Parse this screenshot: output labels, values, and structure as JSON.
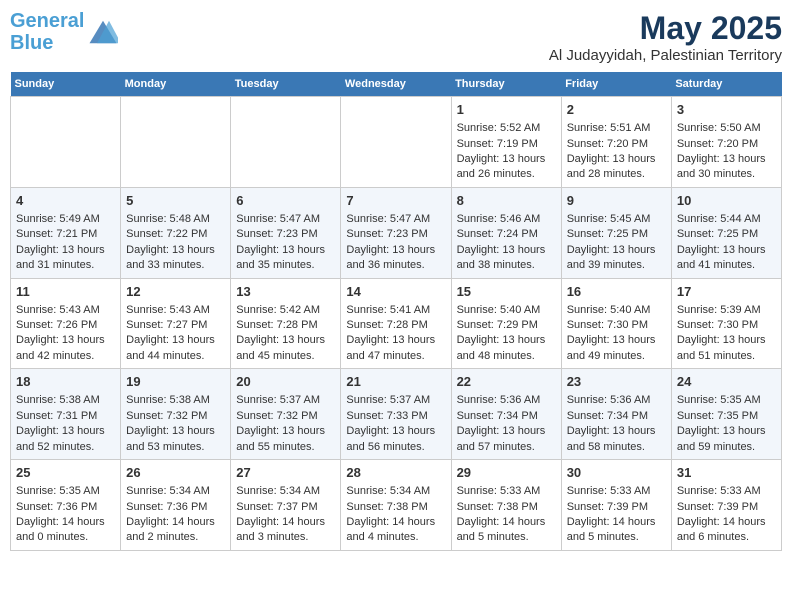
{
  "header": {
    "logo_line1": "General",
    "logo_line2": "Blue",
    "title": "May 2025",
    "subtitle": "Al Judayyidah, Palestinian Territory"
  },
  "weekdays": [
    "Sunday",
    "Monday",
    "Tuesday",
    "Wednesday",
    "Thursday",
    "Friday",
    "Saturday"
  ],
  "weeks": [
    [
      {
        "day": "",
        "content": ""
      },
      {
        "day": "",
        "content": ""
      },
      {
        "day": "",
        "content": ""
      },
      {
        "day": "",
        "content": ""
      },
      {
        "day": "1",
        "content": "Sunrise: 5:52 AM\nSunset: 7:19 PM\nDaylight: 13 hours\nand 26 minutes."
      },
      {
        "day": "2",
        "content": "Sunrise: 5:51 AM\nSunset: 7:20 PM\nDaylight: 13 hours\nand 28 minutes."
      },
      {
        "day": "3",
        "content": "Sunrise: 5:50 AM\nSunset: 7:20 PM\nDaylight: 13 hours\nand 30 minutes."
      }
    ],
    [
      {
        "day": "4",
        "content": "Sunrise: 5:49 AM\nSunset: 7:21 PM\nDaylight: 13 hours\nand 31 minutes."
      },
      {
        "day": "5",
        "content": "Sunrise: 5:48 AM\nSunset: 7:22 PM\nDaylight: 13 hours\nand 33 minutes."
      },
      {
        "day": "6",
        "content": "Sunrise: 5:47 AM\nSunset: 7:23 PM\nDaylight: 13 hours\nand 35 minutes."
      },
      {
        "day": "7",
        "content": "Sunrise: 5:47 AM\nSunset: 7:23 PM\nDaylight: 13 hours\nand 36 minutes."
      },
      {
        "day": "8",
        "content": "Sunrise: 5:46 AM\nSunset: 7:24 PM\nDaylight: 13 hours\nand 38 minutes."
      },
      {
        "day": "9",
        "content": "Sunrise: 5:45 AM\nSunset: 7:25 PM\nDaylight: 13 hours\nand 39 minutes."
      },
      {
        "day": "10",
        "content": "Sunrise: 5:44 AM\nSunset: 7:25 PM\nDaylight: 13 hours\nand 41 minutes."
      }
    ],
    [
      {
        "day": "11",
        "content": "Sunrise: 5:43 AM\nSunset: 7:26 PM\nDaylight: 13 hours\nand 42 minutes."
      },
      {
        "day": "12",
        "content": "Sunrise: 5:43 AM\nSunset: 7:27 PM\nDaylight: 13 hours\nand 44 minutes."
      },
      {
        "day": "13",
        "content": "Sunrise: 5:42 AM\nSunset: 7:28 PM\nDaylight: 13 hours\nand 45 minutes."
      },
      {
        "day": "14",
        "content": "Sunrise: 5:41 AM\nSunset: 7:28 PM\nDaylight: 13 hours\nand 47 minutes."
      },
      {
        "day": "15",
        "content": "Sunrise: 5:40 AM\nSunset: 7:29 PM\nDaylight: 13 hours\nand 48 minutes."
      },
      {
        "day": "16",
        "content": "Sunrise: 5:40 AM\nSunset: 7:30 PM\nDaylight: 13 hours\nand 49 minutes."
      },
      {
        "day": "17",
        "content": "Sunrise: 5:39 AM\nSunset: 7:30 PM\nDaylight: 13 hours\nand 51 minutes."
      }
    ],
    [
      {
        "day": "18",
        "content": "Sunrise: 5:38 AM\nSunset: 7:31 PM\nDaylight: 13 hours\nand 52 minutes."
      },
      {
        "day": "19",
        "content": "Sunrise: 5:38 AM\nSunset: 7:32 PM\nDaylight: 13 hours\nand 53 minutes."
      },
      {
        "day": "20",
        "content": "Sunrise: 5:37 AM\nSunset: 7:32 PM\nDaylight: 13 hours\nand 55 minutes."
      },
      {
        "day": "21",
        "content": "Sunrise: 5:37 AM\nSunset: 7:33 PM\nDaylight: 13 hours\nand 56 minutes."
      },
      {
        "day": "22",
        "content": "Sunrise: 5:36 AM\nSunset: 7:34 PM\nDaylight: 13 hours\nand 57 minutes."
      },
      {
        "day": "23",
        "content": "Sunrise: 5:36 AM\nSunset: 7:34 PM\nDaylight: 13 hours\nand 58 minutes."
      },
      {
        "day": "24",
        "content": "Sunrise: 5:35 AM\nSunset: 7:35 PM\nDaylight: 13 hours\nand 59 minutes."
      }
    ],
    [
      {
        "day": "25",
        "content": "Sunrise: 5:35 AM\nSunset: 7:36 PM\nDaylight: 14 hours\nand 0 minutes."
      },
      {
        "day": "26",
        "content": "Sunrise: 5:34 AM\nSunset: 7:36 PM\nDaylight: 14 hours\nand 2 minutes."
      },
      {
        "day": "27",
        "content": "Sunrise: 5:34 AM\nSunset: 7:37 PM\nDaylight: 14 hours\nand 3 minutes."
      },
      {
        "day": "28",
        "content": "Sunrise: 5:34 AM\nSunset: 7:38 PM\nDaylight: 14 hours\nand 4 minutes."
      },
      {
        "day": "29",
        "content": "Sunrise: 5:33 AM\nSunset: 7:38 PM\nDaylight: 14 hours\nand 5 minutes."
      },
      {
        "day": "30",
        "content": "Sunrise: 5:33 AM\nSunset: 7:39 PM\nDaylight: 14 hours\nand 5 minutes."
      },
      {
        "day": "31",
        "content": "Sunrise: 5:33 AM\nSunset: 7:39 PM\nDaylight: 14 hours\nand 6 minutes."
      }
    ]
  ]
}
